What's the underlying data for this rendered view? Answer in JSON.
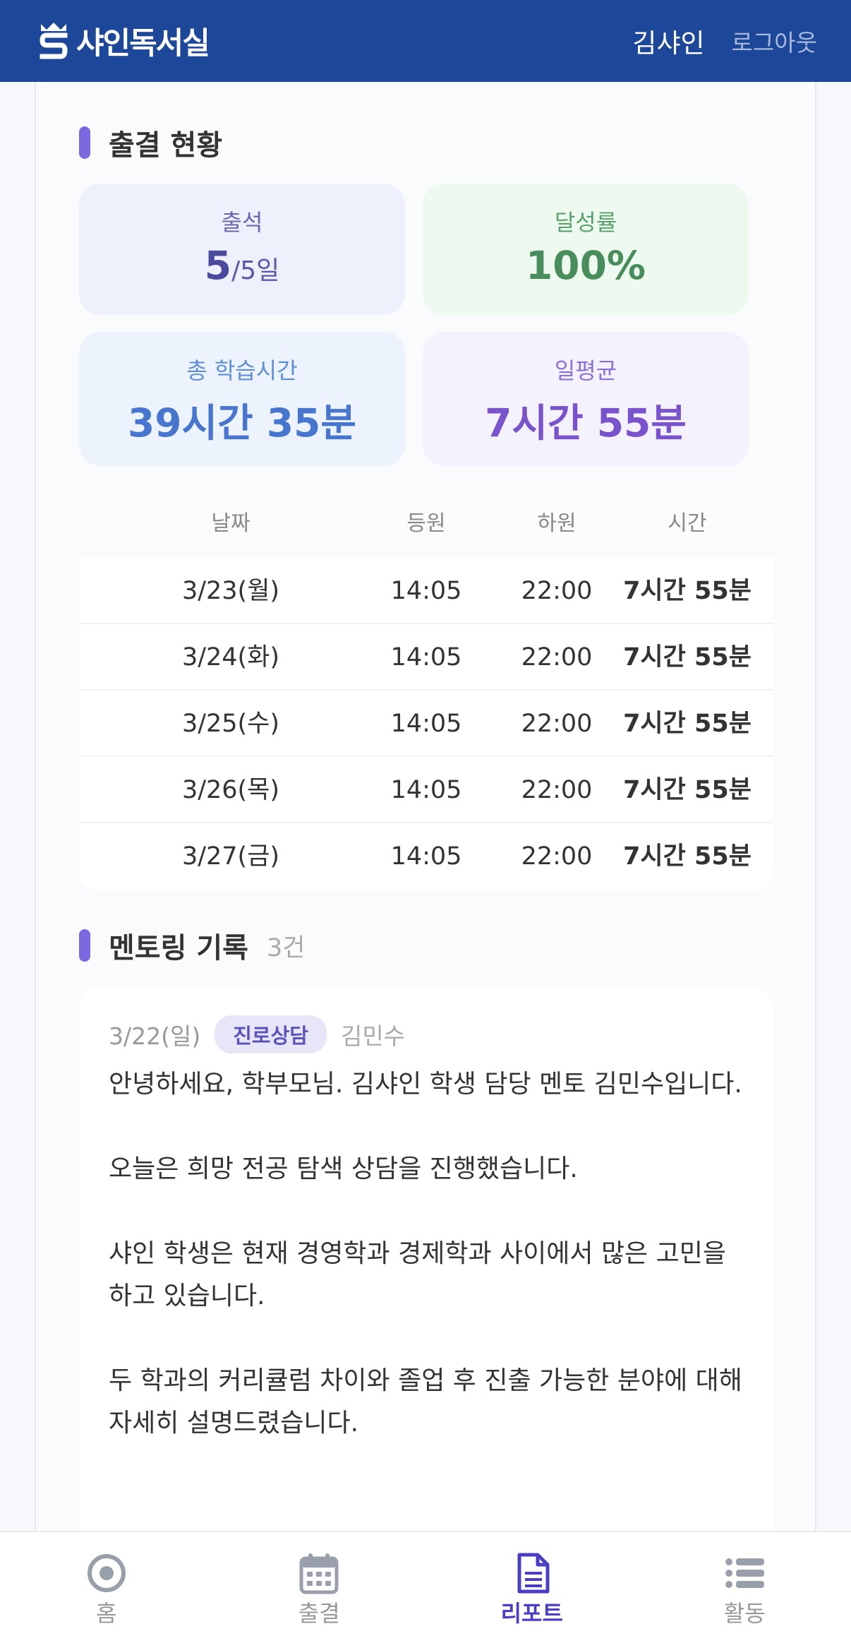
{
  "header": {
    "logo_text": "샤인독서실",
    "user_name": "김샤인",
    "logout_label": "로그아웃"
  },
  "attendance": {
    "title": "출결 현황",
    "stats": {
      "attendance_label": "출석",
      "attendance_value": "5",
      "attendance_total": "/5일",
      "rate_label": "달성률",
      "rate_value": "100%",
      "total_label": "총 학습시간",
      "total_value": "39시간 35분",
      "avg_label": "일평균",
      "avg_value": "7시간 55분"
    },
    "table": {
      "headers": [
        "날짜",
        "등원",
        "하원",
        "시간"
      ],
      "rows": [
        {
          "date": "3/23(월)",
          "in": "14:05",
          "out": "22:00",
          "duration": "7시간 55분"
        },
        {
          "date": "3/24(화)",
          "in": "14:05",
          "out": "22:00",
          "duration": "7시간 55분"
        },
        {
          "date": "3/25(수)",
          "in": "14:05",
          "out": "22:00",
          "duration": "7시간 55분"
        },
        {
          "date": "3/26(목)",
          "in": "14:05",
          "out": "22:00",
          "duration": "7시간 55분"
        },
        {
          "date": "3/27(금)",
          "in": "14:05",
          "out": "22:00",
          "duration": "7시간 55분"
        }
      ]
    }
  },
  "mentoring": {
    "title": "멘토링 기록",
    "count": "3건",
    "records": [
      {
        "date": "3/22(일)",
        "tag": "진로상담",
        "mentor": "김민수",
        "text": "안녕하세요, 학부모님. 김샤인 학생 담당 멘토 김민수입니다.\n\n오늘은 희망 전공 탐색 상담을 진행했습니다.\n\n샤인 학생은 현재 경영학과 경제학과 사이에서 많은 고민을 하고 있습니다.\n\n두 학과의 커리큘럼 차이와 졸업 후 진출 가능한 분야에 대해 자세히 설명드렸습니다."
      }
    ]
  },
  "nav": {
    "items": [
      {
        "label": "홈",
        "icon": "home-target-icon",
        "active": false
      },
      {
        "label": "출결",
        "icon": "calendar-icon",
        "active": false
      },
      {
        "label": "리포트",
        "icon": "document-icon",
        "active": true
      },
      {
        "label": "활동",
        "icon": "list-icon",
        "active": false
      }
    ]
  },
  "colors": {
    "header_bg": "#1d4799",
    "accent": "#7c69e0",
    "nav_active": "#4a3fc2",
    "nav_inactive": "#9aa0ab"
  }
}
